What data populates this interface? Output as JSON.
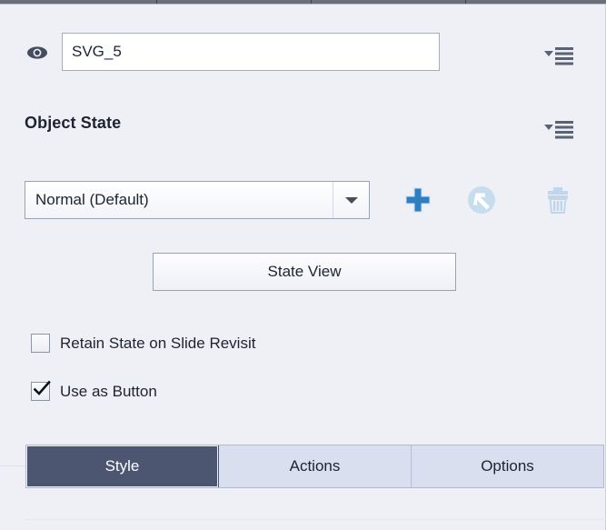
{
  "panel": {
    "object_name": {
      "value": "SVG_5",
      "visibility_icon": "eye-icon",
      "menu_icon": "hamburger-menu-icon"
    },
    "section": {
      "title": "Object State",
      "menu_icon": "hamburger-menu-icon"
    },
    "state_row": {
      "selected_state": "Normal (Default)",
      "options": [
        "Normal (Default)"
      ],
      "dropdown_icon": "chevron-down-icon",
      "add_icon": "plus-icon",
      "reset_icon": "reset-arrow-icon",
      "delete_icon": "trash-icon"
    },
    "state_view_button": "State View",
    "checkboxes": [
      {
        "label": "Retain State on Slide Revisit",
        "checked": false
      },
      {
        "label": "Use as Button",
        "checked": true
      }
    ],
    "tabs": [
      {
        "label": "Style",
        "active": true
      },
      {
        "label": "Actions",
        "active": false
      },
      {
        "label": "Options",
        "active": false
      }
    ]
  },
  "colors": {
    "panel_background": "#eef0f5",
    "accent_blue": "#2d7fc1",
    "disabled_blue": "#bcd6ea",
    "active_tab": "#4c5670",
    "tab_background": "#dadff0",
    "text": "#1d2330"
  }
}
